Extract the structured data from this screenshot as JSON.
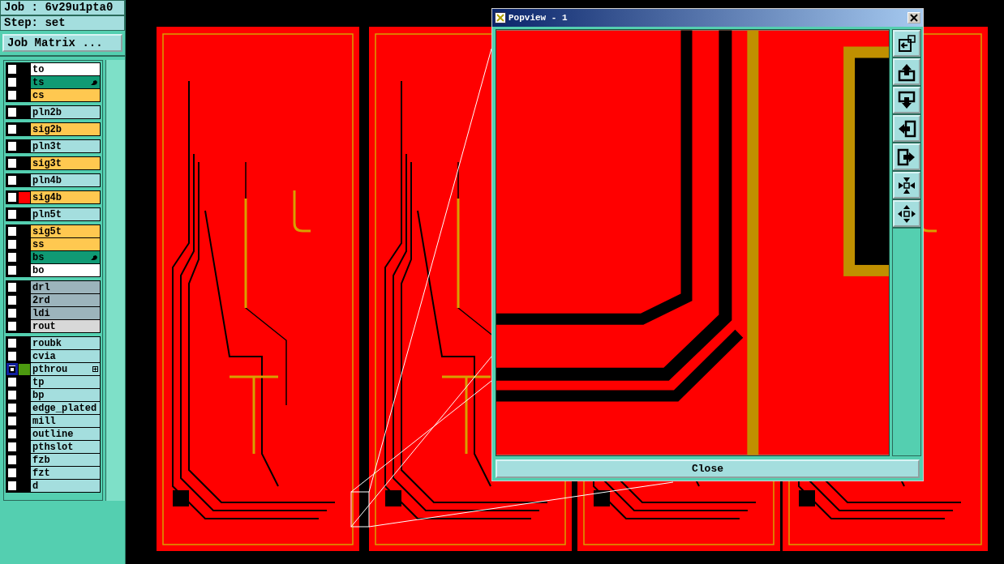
{
  "job_panel": {
    "job": "Job : 6v29u1pta0",
    "step": "Step: set",
    "matrix_button": "Job Matrix ..."
  },
  "layer_groups": [
    {
      "layers": [
        {
          "name": "to",
          "kind": "silk",
          "selected": false,
          "pointer": false,
          "expandable": false
        },
        {
          "name": "ts",
          "kind": "mask",
          "selected": false,
          "pointer": true,
          "expandable": false
        },
        {
          "name": "cs",
          "kind": "signal",
          "selected": false,
          "pointer": false,
          "expandable": false
        }
      ]
    },
    {
      "layers": [
        {
          "name": "pln2b",
          "kind": "plane",
          "selected": false,
          "pointer": false,
          "expandable": false
        }
      ]
    },
    {
      "layers": [
        {
          "name": "sig2b",
          "kind": "signal",
          "selected": false,
          "pointer": false,
          "expandable": false
        }
      ]
    },
    {
      "layers": [
        {
          "name": "pln3t",
          "kind": "plane",
          "selected": false,
          "pointer": false,
          "expandable": false
        }
      ]
    },
    {
      "layers": [
        {
          "name": "sig3t",
          "kind": "signal",
          "selected": false,
          "pointer": false,
          "expandable": false
        }
      ]
    },
    {
      "layers": [
        {
          "name": "pln4b",
          "kind": "plane",
          "selected": false,
          "pointer": false,
          "expandable": false
        }
      ]
    },
    {
      "layers": [
        {
          "name": "sig4b",
          "kind": "signal",
          "color": "#ff0000",
          "selected": false,
          "pointer": false,
          "expandable": false
        }
      ]
    },
    {
      "layers": [
        {
          "name": "pln5t",
          "kind": "plane",
          "selected": false,
          "pointer": false,
          "expandable": false
        }
      ]
    },
    {
      "layers": [
        {
          "name": "sig5t",
          "kind": "signal",
          "selected": false,
          "pointer": false,
          "expandable": false
        },
        {
          "name": "ss",
          "kind": "signal",
          "selected": false,
          "pointer": false,
          "expandable": false
        },
        {
          "name": "bs",
          "kind": "mask",
          "selected": false,
          "pointer": true,
          "expandable": false
        },
        {
          "name": "bo",
          "kind": "silk",
          "selected": false,
          "pointer": false,
          "expandable": false
        }
      ]
    },
    {
      "layers": [
        {
          "name": "drl",
          "kind": "drill",
          "selected": false,
          "pointer": false,
          "expandable": false
        },
        {
          "name": "2rd",
          "kind": "drill",
          "selected": false,
          "pointer": false,
          "expandable": false
        },
        {
          "name": "ldi",
          "kind": "drill",
          "selected": false,
          "pointer": false,
          "expandable": false
        },
        {
          "name": "rout",
          "kind": "rout",
          "selected": false,
          "pointer": false,
          "expandable": false
        }
      ]
    },
    {
      "layers": [
        {
          "name": "roubk",
          "kind": "misc",
          "selected": false,
          "pointer": false,
          "expandable": false
        },
        {
          "name": "cvia",
          "kind": "misc",
          "selected": false,
          "pointer": false,
          "expandable": false
        },
        {
          "name": "pthrou",
          "kind": "misc",
          "color": "#4c9a10",
          "selected": true,
          "pointer": false,
          "expandable": true
        },
        {
          "name": "tp",
          "kind": "misc",
          "selected": false,
          "pointer": false,
          "expandable": false
        },
        {
          "name": "bp",
          "kind": "misc",
          "selected": false,
          "pointer": false,
          "expandable": false
        },
        {
          "name": "edge_plated",
          "kind": "misc",
          "selected": false,
          "pointer": false,
          "expandable": false
        },
        {
          "name": "mill",
          "kind": "misc",
          "selected": false,
          "pointer": false,
          "expandable": false
        },
        {
          "name": "outline",
          "kind": "misc",
          "selected": false,
          "pointer": false,
          "expandable": false
        },
        {
          "name": "pthslot",
          "kind": "misc",
          "selected": false,
          "pointer": false,
          "expandable": false
        },
        {
          "name": "fzb",
          "kind": "misc",
          "selected": false,
          "pointer": false,
          "expandable": false
        },
        {
          "name": "fzt",
          "kind": "misc",
          "selected": false,
          "pointer": false,
          "expandable": false
        },
        {
          "name": "d",
          "kind": "misc",
          "selected": false,
          "pointer": false,
          "expandable": false
        }
      ]
    }
  ],
  "popview": {
    "title": "Popview - 1",
    "close_button": "Close"
  }
}
